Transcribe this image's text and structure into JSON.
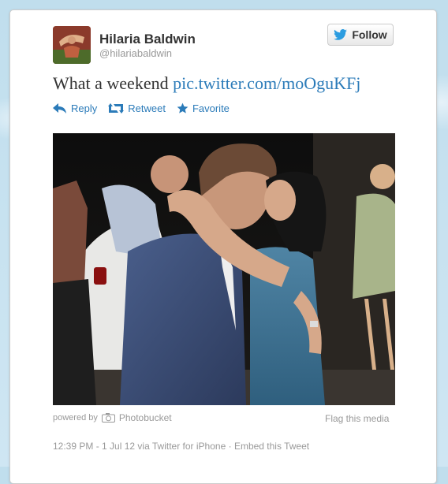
{
  "user": {
    "name": "Hilaria Baldwin",
    "handle": "@hilariabaldwin"
  },
  "follow_label": "Follow",
  "tweet": {
    "text": "What a weekend",
    "link": "pic.twitter.com/moOguKFj"
  },
  "actions": {
    "reply": "Reply",
    "retweet": "Retweet",
    "favorite": "Favorite"
  },
  "media": {
    "powered_by": "powered by",
    "provider": "Photobucket",
    "flag": "Flag this media"
  },
  "meta": {
    "time": "12:39 PM - 1 Jul 12",
    "via": "via Twitter for iPhone",
    "separator": "·",
    "embed": "Embed this Tweet"
  },
  "colors": {
    "link": "#2b7bb9",
    "background": "#c0deed"
  }
}
